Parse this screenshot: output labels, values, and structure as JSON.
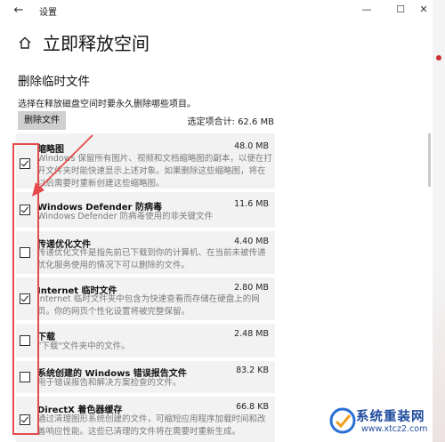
{
  "window": {
    "title": "设置",
    "back_glyph": "←",
    "controls": {
      "minimize": "—",
      "maximize": "☐",
      "close": "✕"
    }
  },
  "page": {
    "title": "立即释放空间",
    "section_title": "删除临时文件",
    "description": "选择在释放磁盘空间时要永久删除哪些项目。",
    "delete_button": "删除文件",
    "total_selected": "选定项合计: 62.6 MB"
  },
  "items": [
    {
      "name": "缩略图",
      "size": "48.0 MB",
      "checked": true,
      "description": "Windows 保留所有图片、视频和文档缩略图的副本，以便在打开文件夹时能快速显示上述对象。如果删除这些缩略图，将在以后需要时重新创建这些缩略图。"
    },
    {
      "name": "Windows Defender 防病毒",
      "size": "11.6 MB",
      "checked": true,
      "description": "Windows Defender 防病毒使用的非关键文件"
    },
    {
      "name": "传递优化文件",
      "size": "4.40 MB",
      "checked": false,
      "description": "传递优化文件是指先前已下载到你的计算机、在当前未被传递优化服务使用的情况下可以删除的文件。"
    },
    {
      "name": "Internet 临时文件",
      "size": "2.80 MB",
      "checked": true,
      "description": "Internet 临时文件夹中包含为快速查看而存储在硬盘上的网页。你的网页个性化设置将被完整保留。"
    },
    {
      "name": "下载",
      "size": "2.48 MB",
      "checked": false,
      "description": "\"下载\"文件夹中的文件。"
    },
    {
      "name": "系统创建的 Windows 错误报告文件",
      "size": "83.2 KB",
      "checked": false,
      "description": "用于错误报告和解决方案检查的文件。"
    },
    {
      "name": "DirectX 着色器缓存",
      "size": "66.8 KB",
      "checked": true,
      "description": "通过清理图形系统创建的文件，可缩短应用程序加载时间和改善响应性能。这些已清理的文件将在需要时重新生成。"
    }
  ],
  "watermark": {
    "text": "系统重装网",
    "url": "www.xtcz2.com"
  },
  "colors": {
    "annotation": "#e44a4a",
    "item_bg": "#f2f2f2",
    "button_bg": "#cfcfcf",
    "watermark": "#1f4c9e"
  },
  "icons": {
    "home": "home-icon",
    "back": "back-arrow-icon",
    "arrow": "annotation-arrow"
  }
}
